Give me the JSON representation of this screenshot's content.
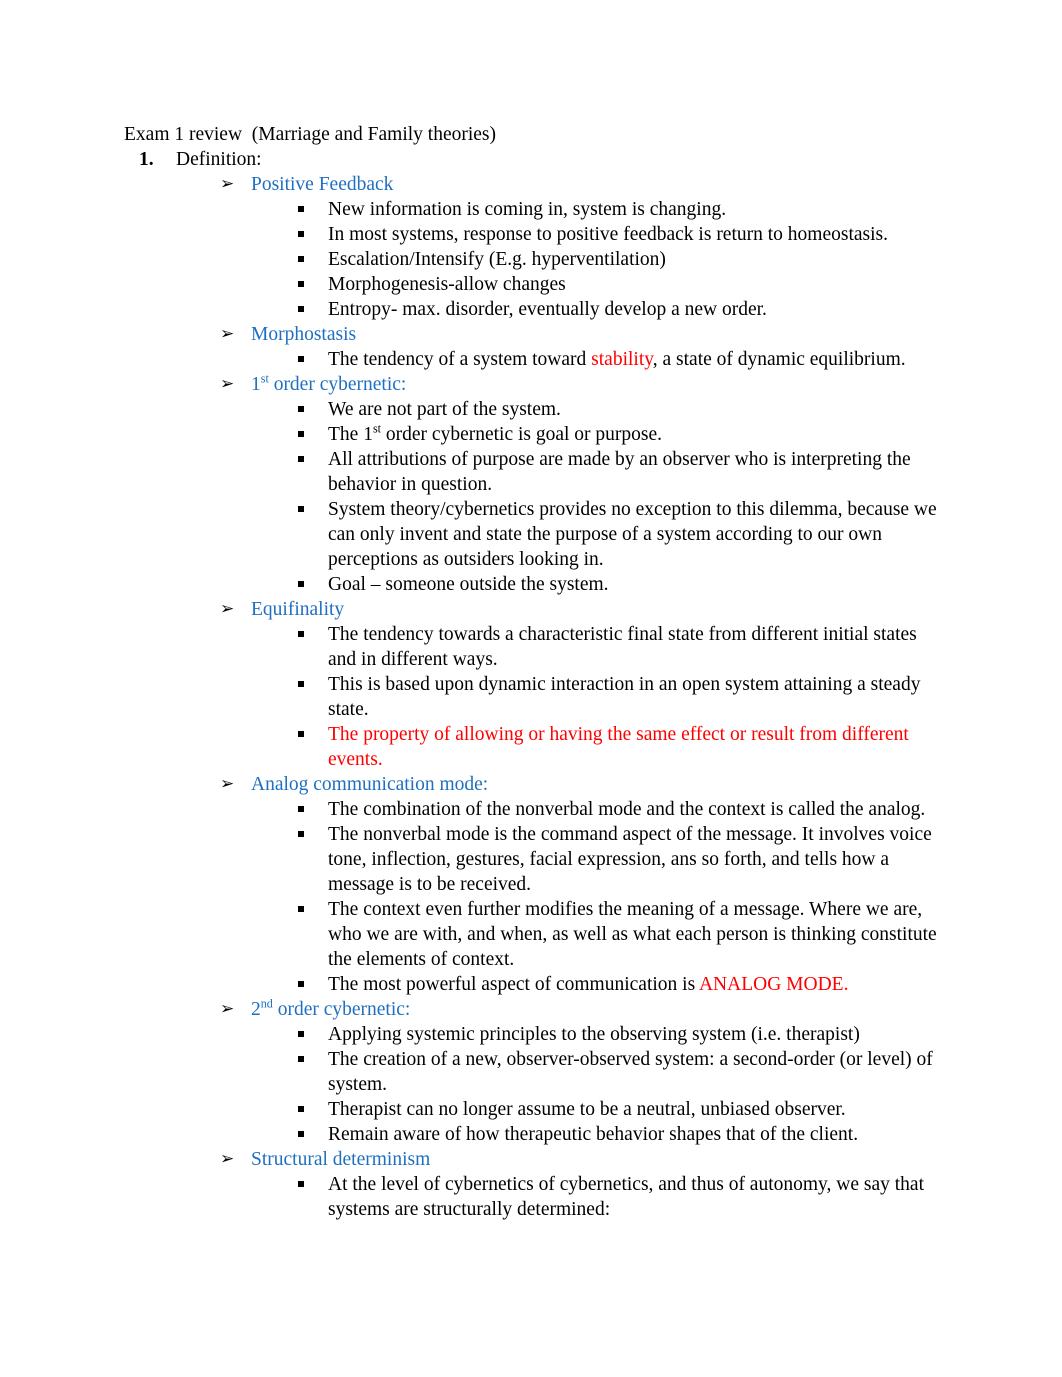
{
  "document": {
    "title": "Exam 1 review  (Marriage and Family theories)",
    "section_number": "1.",
    "section_label": "Definition:",
    "colors": {
      "heading_blue": "#1F6FC0",
      "emphasis_red": "#FF0000",
      "body_black": "#000000",
      "page_background": "#FFFFFF"
    },
    "bullets": {
      "arrow_glyph": "➢",
      "square_glyph": "▪"
    }
  },
  "sections": [
    {
      "heading": "Positive Feedback",
      "heading_parts": [
        {
          "text": "Positive Feedback",
          "style": "blue"
        }
      ],
      "items": [
        {
          "parts": [
            {
              "text": "New information is coming in, system is changing.",
              "style": "black"
            }
          ]
        },
        {
          "parts": [
            {
              "text": "In most systems, response to positive feedback is return to homeostasis.",
              "style": "black"
            }
          ]
        },
        {
          "parts": [
            {
              "text": "Escalation/Intensify (E.g. hyperventilation)",
              "style": "black"
            }
          ]
        },
        {
          "parts": [
            {
              "text": "Morphogenesis-allow changes",
              "style": "black"
            }
          ]
        },
        {
          "parts": [
            {
              "text": "Entropy- max. disorder, eventually develop a new order.",
              "style": "black"
            }
          ]
        }
      ]
    },
    {
      "heading": "Morphostasis",
      "heading_parts": [
        {
          "text": "Morphostasis",
          "style": "blue"
        }
      ],
      "items": [
        {
          "parts": [
            {
              "text": "The tendency of a system toward ",
              "style": "black"
            },
            {
              "text": "stability",
              "style": "red"
            },
            {
              "text": ", a state of dynamic equilibrium.",
              "style": "black"
            }
          ]
        }
      ]
    },
    {
      "heading": "1st order cybernetic:",
      "heading_parts": [
        {
          "text": "1",
          "style": "blue"
        },
        {
          "text": "st",
          "style": "blue-sup"
        },
        {
          "text": " order cybernetic:",
          "style": "blue"
        }
      ],
      "items": [
        {
          "parts": [
            {
              "text": "We are not part of the system.",
              "style": "black"
            }
          ]
        },
        {
          "parts": [
            {
              "text": "The 1",
              "style": "black"
            },
            {
              "text": "st",
              "style": "black-sup"
            },
            {
              "text": " order cybernetic is goal or purpose.",
              "style": "black"
            }
          ]
        },
        {
          "parts": [
            {
              "text": "All attributions of purpose are made by an observer who is interpreting the behavior in question.",
              "style": "black"
            }
          ]
        },
        {
          "parts": [
            {
              "text": "System theory/cybernetics provides no exception to this dilemma, because we can only invent and state the purpose of a system according to our own perceptions as outsiders looking in.",
              "style": "black"
            }
          ]
        },
        {
          "parts": [
            {
              "text": "Goal – someone outside the system.",
              "style": "black"
            }
          ]
        }
      ]
    },
    {
      "heading": "Equifinality",
      "heading_parts": [
        {
          "text": "Equifinality",
          "style": "blue"
        }
      ],
      "items": [
        {
          "parts": [
            {
              "text": "The tendency towards a characteristic final state from different initial states and in different ways.",
              "style": "black"
            }
          ]
        },
        {
          "parts": [
            {
              "text": "This is based upon dynamic interaction in an open system attaining a steady state.",
              "style": "black"
            }
          ]
        },
        {
          "parts": [
            {
              "text": "The property of allowing or having the same effect or result from different events.",
              "style": "red"
            }
          ]
        }
      ]
    },
    {
      "heading": "Analog communication mode:",
      "heading_parts": [
        {
          "text": "Analog communication mode:",
          "style": "blue"
        }
      ],
      "items": [
        {
          "parts": [
            {
              "text": "The combination of the nonverbal mode and the context is called the analog.",
              "style": "black"
            }
          ]
        },
        {
          "parts": [
            {
              "text": "The nonverbal mode is the command aspect of the message. It involves voice tone, inflection, gestures, facial expression, ans so forth, and tells how a message is to be received.",
              "style": "black"
            }
          ]
        },
        {
          "parts": [
            {
              "text": "The context even further modifies the meaning of a message. Where we are, who we are with, and when, as well as what each person is thinking constitute the elements of context.",
              "style": "black"
            }
          ]
        },
        {
          "parts": [
            {
              "text": "The most powerful aspect of communication is ",
              "style": "black"
            },
            {
              "text": "ANALOG MODE.",
              "style": "red"
            }
          ]
        }
      ]
    },
    {
      "heading": "2nd order cybernetic:",
      "heading_parts": [
        {
          "text": "2",
          "style": "blue"
        },
        {
          "text": "nd",
          "style": "blue-sup"
        },
        {
          "text": " order cybernetic:",
          "style": "blue"
        }
      ],
      "items": [
        {
          "parts": [
            {
              "text": "Applying systemic principles to the observing system (i.e. therapist)",
              "style": "black"
            }
          ]
        },
        {
          "parts": [
            {
              "text": "The creation of a new, observer-observed system: a second-order (or level) of system.",
              "style": "black"
            }
          ]
        },
        {
          "parts": [
            {
              "text": "Therapist can no longer assume to be a neutral, unbiased observer.",
              "style": "black"
            }
          ]
        },
        {
          "parts": [
            {
              "text": "Remain aware of how therapeutic behavior shapes that of the client.",
              "style": "black"
            }
          ]
        }
      ]
    },
    {
      "heading": "Structural determinism",
      "heading_parts": [
        {
          "text": "Structural determinism",
          "style": "blue"
        }
      ],
      "items": [
        {
          "parts": [
            {
              "text": " At the level of cybernetics of cybernetics, and thus of autonomy, we say that systems are structurally determined:",
              "style": "black"
            }
          ]
        }
      ]
    }
  ]
}
